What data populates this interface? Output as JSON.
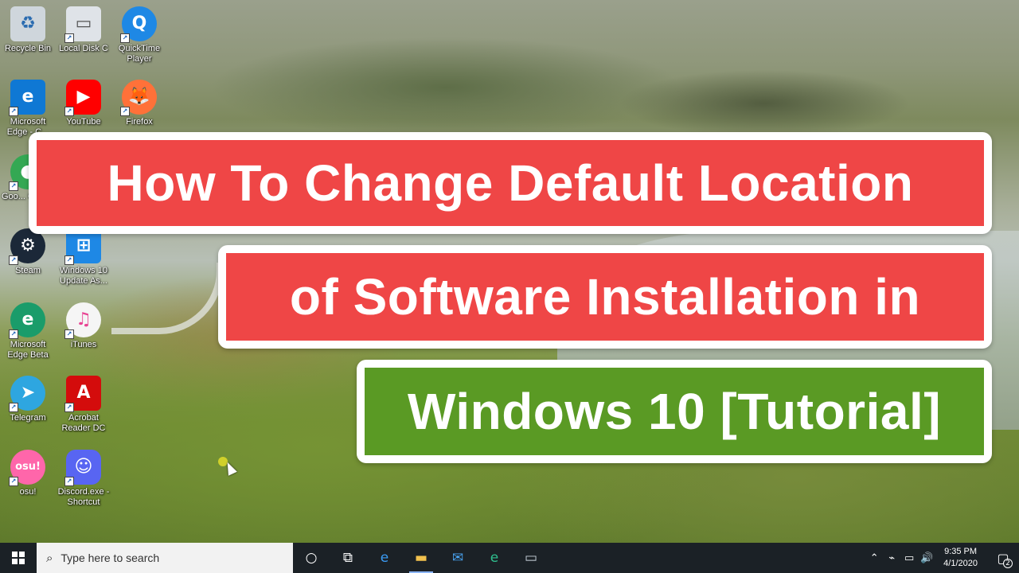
{
  "desktop": {
    "icons": [
      {
        "label": "Recycle Bin",
        "icon": "recycle-bin-icon",
        "color": "#cfd6dc"
      },
      {
        "label": "Local Disk C",
        "icon": "drive-icon",
        "color": "#dfe3e8"
      },
      {
        "label": "QuickTime Player",
        "icon": "quicktime-icon",
        "color": "#1e88e5"
      },
      {
        "label": "Microsoft Edge - C...",
        "icon": "edge-icon",
        "color": "#0f78d4"
      },
      {
        "label": "YouTube",
        "icon": "youtube-icon",
        "color": "#ff0000"
      },
      {
        "label": "Firefox",
        "icon": "firefox-icon",
        "color": "#ff7139"
      },
      {
        "label": "Goo... Chro...",
        "icon": "chrome-icon",
        "color": "#34a853"
      },
      {
        "label": "Steam",
        "icon": "steam-icon",
        "color": "#1b2838"
      },
      {
        "label": "Windows 10 Update As...",
        "icon": "windows-update-icon",
        "color": "#1e88e5"
      },
      {
        "label": "Microsoft Edge Beta",
        "icon": "edge-beta-icon",
        "color": "#1a9c6a"
      },
      {
        "label": "iTunes",
        "icon": "itunes-icon",
        "color": "#f5f5f5"
      },
      {
        "label": "Telegram",
        "icon": "telegram-icon",
        "color": "#2ea6e0"
      },
      {
        "label": "Acrobat Reader DC",
        "icon": "acrobat-icon",
        "color": "#d40c0c"
      },
      {
        "label": "osu!",
        "icon": "osu-icon",
        "color": "#ff66aa"
      },
      {
        "label": "Discord.exe - Shortcut",
        "icon": "discord-icon",
        "color": "#5865f2"
      }
    ]
  },
  "banners": {
    "line1": "How To Change Default Location",
    "line2": "of Software Installation in",
    "line3": "Windows 10 [Tutorial]"
  },
  "taskbar": {
    "search_placeholder": "Type here to search",
    "pinned": [
      {
        "name": "task-view-icon"
      },
      {
        "name": "edge-icon"
      },
      {
        "name": "file-explorer-icon"
      },
      {
        "name": "mail-icon"
      },
      {
        "name": "edge-beta-icon"
      },
      {
        "name": "disk-icon"
      }
    ],
    "clock_time": "9:35 PM",
    "clock_date": "4/1/2020",
    "notification_count": "2"
  },
  "colors": {
    "banner_red": "#ef4646",
    "banner_green": "#5a9a24",
    "taskbar": "#1b2126"
  }
}
